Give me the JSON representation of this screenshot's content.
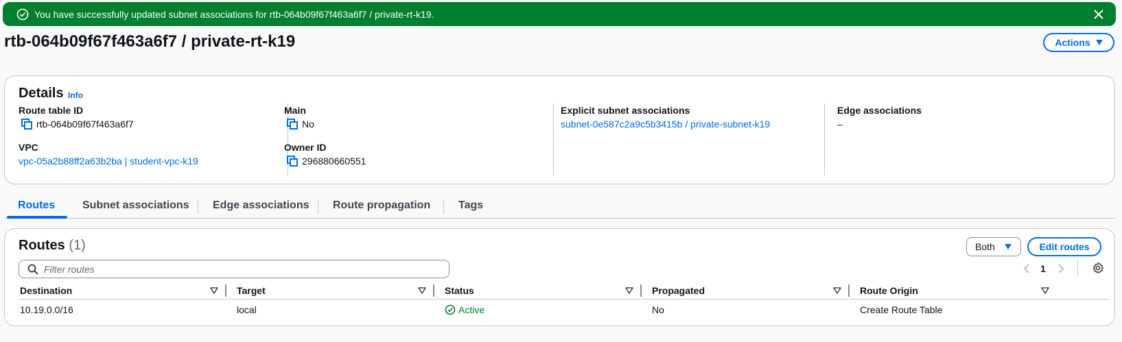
{
  "flash": {
    "message": "You have successfully updated subnet associations for rtb-064b09f67f463a6f7 / private-rt-k19."
  },
  "header": {
    "title": "rtb-064b09f67f463a6f7 / private-rt-k19",
    "actions_label": "Actions"
  },
  "details": {
    "heading": "Details",
    "info_label": "Info",
    "route_table_id_label": "Route table ID",
    "route_table_id_value": "rtb-064b09f67f463a6f7",
    "vpc_label": "VPC",
    "vpc_value": "vpc-05a2b88ff2a63b2ba | student-vpc-k19",
    "main_label": "Main",
    "main_value": "No",
    "owner_id_label": "Owner ID",
    "owner_id_value": "296880660551",
    "explicit_subnet_label": "Explicit subnet associations",
    "explicit_subnet_value": "subnet-0e587c2a9c5b3415b / private-subnet-k19",
    "edge_label": "Edge associations",
    "edge_value": "–"
  },
  "tabs": [
    {
      "label": "Routes",
      "active": true
    },
    {
      "label": "Subnet associations",
      "active": false
    },
    {
      "label": "Edge associations",
      "active": false
    },
    {
      "label": "Route propagation",
      "active": false
    },
    {
      "label": "Tags",
      "active": false
    }
  ],
  "routes": {
    "heading": "Routes",
    "count": "(1)",
    "filter_select": "Both",
    "edit_label": "Edit routes",
    "filter_placeholder": "Filter routes",
    "page": "1",
    "columns": [
      "Destination",
      "Target",
      "Status",
      "Propagated",
      "Route Origin"
    ],
    "rows": [
      {
        "destination": "10.19.0.0/16",
        "target": "local",
        "status": "Active",
        "propagated": "No",
        "origin": "Create Route Table"
      }
    ]
  },
  "colors": {
    "success": "#00802f",
    "accent": "#006ce0"
  }
}
